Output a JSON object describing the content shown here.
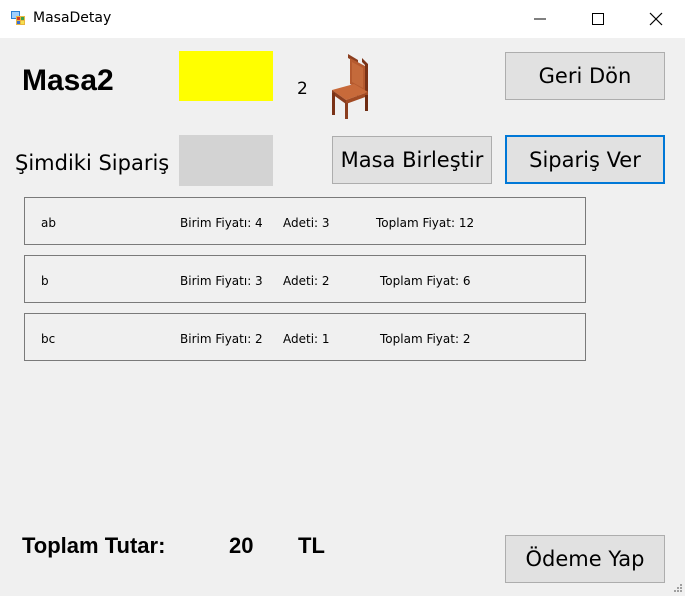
{
  "window": {
    "title": "MasaDetay",
    "app_icon": "winforms-app-icon",
    "controls": {
      "minimize_icon": "minimize-icon",
      "maximize_icon": "maximize-icon",
      "close_icon": "close-icon"
    }
  },
  "table": {
    "name": "Masa2",
    "status_color": "#ffff00",
    "seat_count": "2",
    "chair_icon": "chair-icon"
  },
  "current_order": {
    "label": "Şimdiki Sipariş",
    "field_color": "#d3d3d3"
  },
  "buttons": {
    "back": "Geri Dön",
    "merge": "Masa Birleştir",
    "place_order": "Sipariş Ver",
    "pay": "Ödeme Yap"
  },
  "orders": [
    {
      "name": "ab",
      "unit_price": "Birim Fiyatı: 4",
      "quantity": "Adeti: 3",
      "total": "Toplam Fiyat: 12"
    },
    {
      "name": "b",
      "unit_price": "Birim Fiyatı: 3",
      "quantity": "Adeti: 2",
      "total": "Toplam Fiyat: 6"
    },
    {
      "name": "bc",
      "unit_price": "Birim Fiyatı: 2",
      "quantity": "Adeti: 1",
      "total": "Toplam Fiyat: 2"
    }
  ],
  "summary": {
    "label": "Toplam Tutar:",
    "amount": "20",
    "currency": "TL"
  }
}
